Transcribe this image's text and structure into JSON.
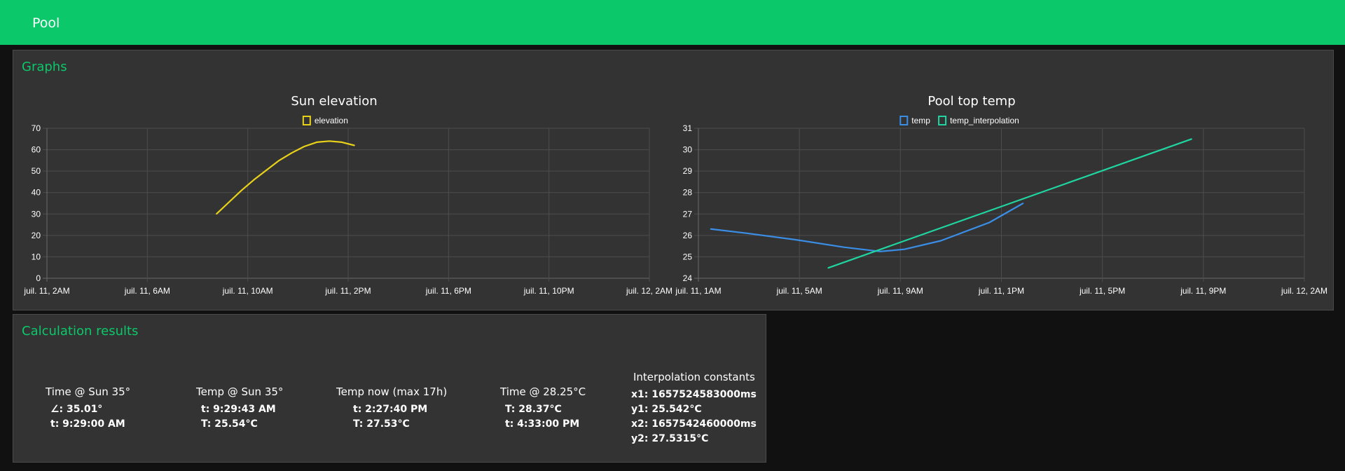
{
  "app": {
    "title": "Pool"
  },
  "graphs_panel": {
    "title": "Graphs"
  },
  "results_panel": {
    "title": "Calculation results"
  },
  "chart_data": [
    {
      "type": "line",
      "title": "Sun elevation",
      "legend": [
        "elevation"
      ],
      "ylim": [
        0,
        70
      ],
      "y_ticks": [
        "0",
        "10",
        "20",
        "30",
        "40",
        "50",
        "60",
        "70"
      ],
      "x_ticks": [
        "juil. 11, 2AM",
        "juil. 11, 6AM",
        "juil. 11, 10AM",
        "juil. 11, 2PM",
        "juil. 11, 6PM",
        "juil. 11, 10PM",
        "juil. 12, 2AM"
      ],
      "xlim_hours": [
        2,
        26
      ],
      "series": [
        {
          "name": "elevation",
          "color": "#e8d219",
          "x_hours": [
            8.75,
            9.25,
            9.75,
            10.25,
            10.75,
            11.25,
            11.75,
            12.25,
            12.75,
            13.25,
            13.75,
            14.25
          ],
          "values": [
            30,
            35.5,
            41,
            46,
            50.5,
            55,
            58.5,
            61.5,
            63.5,
            64,
            63.5,
            62
          ]
        }
      ]
    },
    {
      "type": "line",
      "title": "Pool top temp",
      "legend": [
        "temp",
        "temp_interpolation"
      ],
      "ylim": [
        24,
        31
      ],
      "y_ticks": [
        "24",
        "25",
        "26",
        "27",
        "28",
        "29",
        "30",
        "31"
      ],
      "x_ticks": [
        "juil. 11, 1AM",
        "juil. 11, 5AM",
        "juil. 11, 9AM",
        "juil. 11, 1PM",
        "juil. 11, 5PM",
        "juil. 11, 9PM",
        "juil. 12, 2AM"
      ],
      "xlim_hours": [
        1,
        26
      ],
      "series": [
        {
          "name": "temp",
          "color": "#3a8ee6",
          "x_hours": [
            1.5,
            3,
            5,
            7,
            8.5,
            9.5,
            11,
            13,
            14.4
          ],
          "values": [
            26.3,
            26.1,
            25.8,
            25.45,
            25.25,
            25.35,
            25.75,
            26.6,
            27.5
          ]
        },
        {
          "name": "temp_interpolation",
          "color": "#1fd6a0",
          "x_hours": [
            6.35,
            21.35
          ],
          "values": [
            24.48,
            30.5
          ]
        }
      ]
    }
  ],
  "results": [
    {
      "header": "Time @ Sun 35°",
      "lines": [
        "∠: 35.01°",
        "t: 9:29:00 AM"
      ]
    },
    {
      "header": "Temp @ Sun 35°",
      "lines": [
        "t: 9:29:43 AM",
        "T: 25.54°C"
      ]
    },
    {
      "header": "Temp now (max 17h)",
      "lines": [
        "t: 2:27:40 PM",
        "T: 27.53°C"
      ]
    },
    {
      "header": "Time @ 28.25°C",
      "lines": [
        "T: 28.37°C",
        "t: 4:33:00 PM"
      ]
    },
    {
      "header": "Interpolation constants",
      "lines": [
        "x1: 1657524583000ms",
        "y1: 25.542°C",
        "x2: 1657542460000ms",
        "y2: 27.5315°C"
      ]
    }
  ]
}
